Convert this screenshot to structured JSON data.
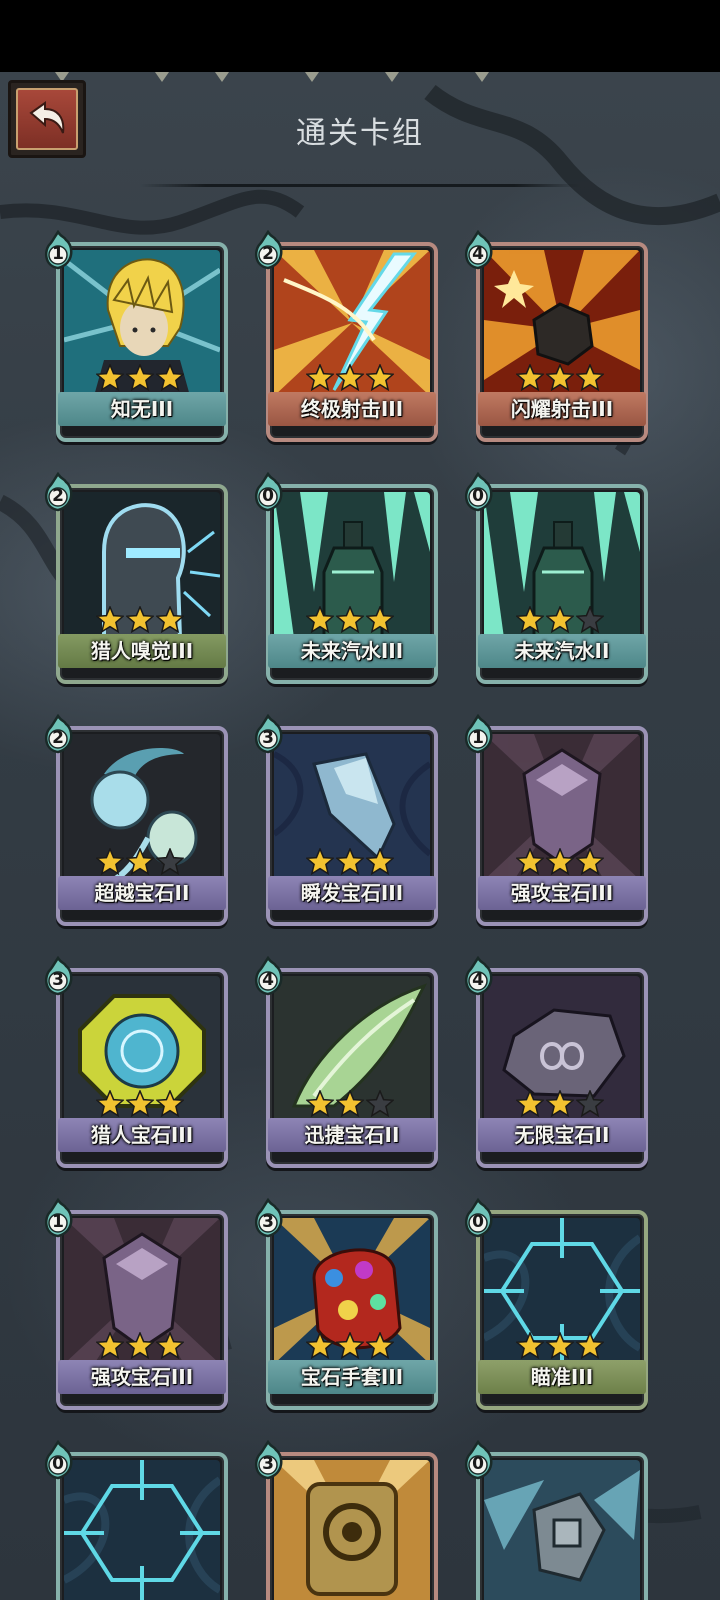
{
  "screen": {
    "title": "通关卡组"
  },
  "cards": [
    {
      "name": "知无III",
      "cost": "1",
      "stars": 3,
      "theme": "teal",
      "art": "blonde-hero"
    },
    {
      "name": "终极射击III",
      "cost": "2",
      "stars": 3,
      "theme": "red",
      "art": "lightning-shot"
    },
    {
      "name": "闪耀射击III",
      "cost": "4",
      "stars": 3,
      "theme": "red",
      "art": "burning-rock"
    },
    {
      "name": "猎人嗅觉III",
      "cost": "2",
      "stars": 3,
      "theme": "green",
      "art": "hunter-head"
    },
    {
      "name": "未来汽水III",
      "cost": "0",
      "stars": 3,
      "theme": "teal",
      "art": "soda-bottle"
    },
    {
      "name": "未来汽水II",
      "cost": "0",
      "stars": 2,
      "theme": "teal",
      "art": "soda-bottle"
    },
    {
      "name": "超越宝石II",
      "cost": "2",
      "stars": 2,
      "theme": "purple",
      "art": "twin-gems"
    },
    {
      "name": "瞬发宝石III",
      "cost": "3",
      "stars": 3,
      "theme": "purple",
      "art": "blue-crystal"
    },
    {
      "name": "强攻宝石III",
      "cost": "1",
      "stars": 3,
      "theme": "purple",
      "art": "purple-gem"
    },
    {
      "name": "猎人宝石III",
      "cost": "3",
      "stars": 3,
      "theme": "purple",
      "art": "gold-octagon"
    },
    {
      "name": "迅捷宝石II",
      "cost": "4",
      "stars": 2,
      "theme": "purple",
      "art": "green-wing"
    },
    {
      "name": "无限宝石II",
      "cost": "4",
      "stars": 2,
      "theme": "purple",
      "art": "infinity-stone"
    },
    {
      "name": "强攻宝石III",
      "cost": "1",
      "stars": 3,
      "theme": "purple",
      "art": "purple-gem"
    },
    {
      "name": "宝石手套III",
      "cost": "3",
      "stars": 3,
      "theme": "teal",
      "art": "gauntlet"
    },
    {
      "name": "瞄准III",
      "cost": "0",
      "stars": 3,
      "theme": "olive",
      "art": "crosshair"
    },
    {
      "name": "",
      "cost": "0",
      "stars": 0,
      "theme": "teal",
      "art": "crosshair"
    },
    {
      "name": "",
      "cost": "3",
      "stars": 0,
      "theme": "red",
      "art": "golden-device"
    },
    {
      "name": "",
      "cost": "0",
      "stars": 0,
      "theme": "teal",
      "art": "robot-arm"
    }
  ],
  "colors": {
    "star_on": "#f2c230",
    "star_off": "#3a3d42",
    "cost_drop": "#6fc3b8"
  }
}
